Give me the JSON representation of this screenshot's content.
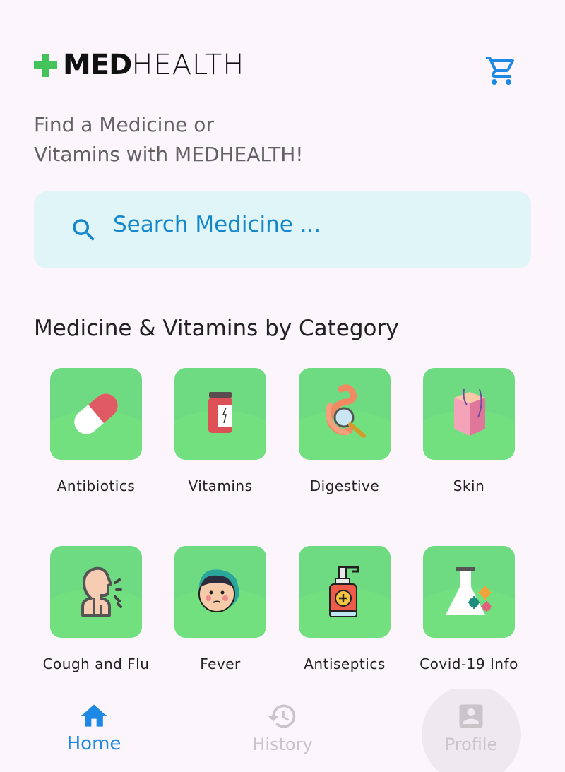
{
  "header": {
    "logo_bold": "MED",
    "logo_light": "HEALTH",
    "brand_color": "#43c35a",
    "cart_icon": "cart-icon"
  },
  "tagline": {
    "line1": "Find a Medicine or",
    "line2": "Vitamins with MEDHEALTH!"
  },
  "search": {
    "placeholder": "Search Medicine ...",
    "icon": "search-icon",
    "accent": "#1486cc"
  },
  "categories": {
    "title": "Medicine & Vitamins by Category",
    "items": [
      {
        "label": "Antibiotics",
        "icon": "capsule-icon"
      },
      {
        "label": "Vitamins",
        "icon": "vitamin-bottle-icon"
      },
      {
        "label": "Digestive",
        "icon": "intestine-icon"
      },
      {
        "label": "Skin",
        "icon": "skin-layer-icon"
      },
      {
        "label": "Cough and Flu",
        "icon": "cough-person-icon"
      },
      {
        "label": "Fever",
        "icon": "fever-face-icon"
      },
      {
        "label": "Antiseptics",
        "icon": "antiseptic-bottle-icon"
      },
      {
        "label": "Covid-19 Info",
        "icon": "flask-virus-icon"
      }
    ]
  },
  "bottom_nav": {
    "items": [
      {
        "label": "Home",
        "icon": "home-icon",
        "active": true
      },
      {
        "label": "History",
        "icon": "history-icon",
        "active": false
      },
      {
        "label": "Profile",
        "icon": "profile-icon",
        "active": false
      }
    ],
    "active_color": "#1e88e5",
    "inactive_color": "#c8c4c8"
  }
}
